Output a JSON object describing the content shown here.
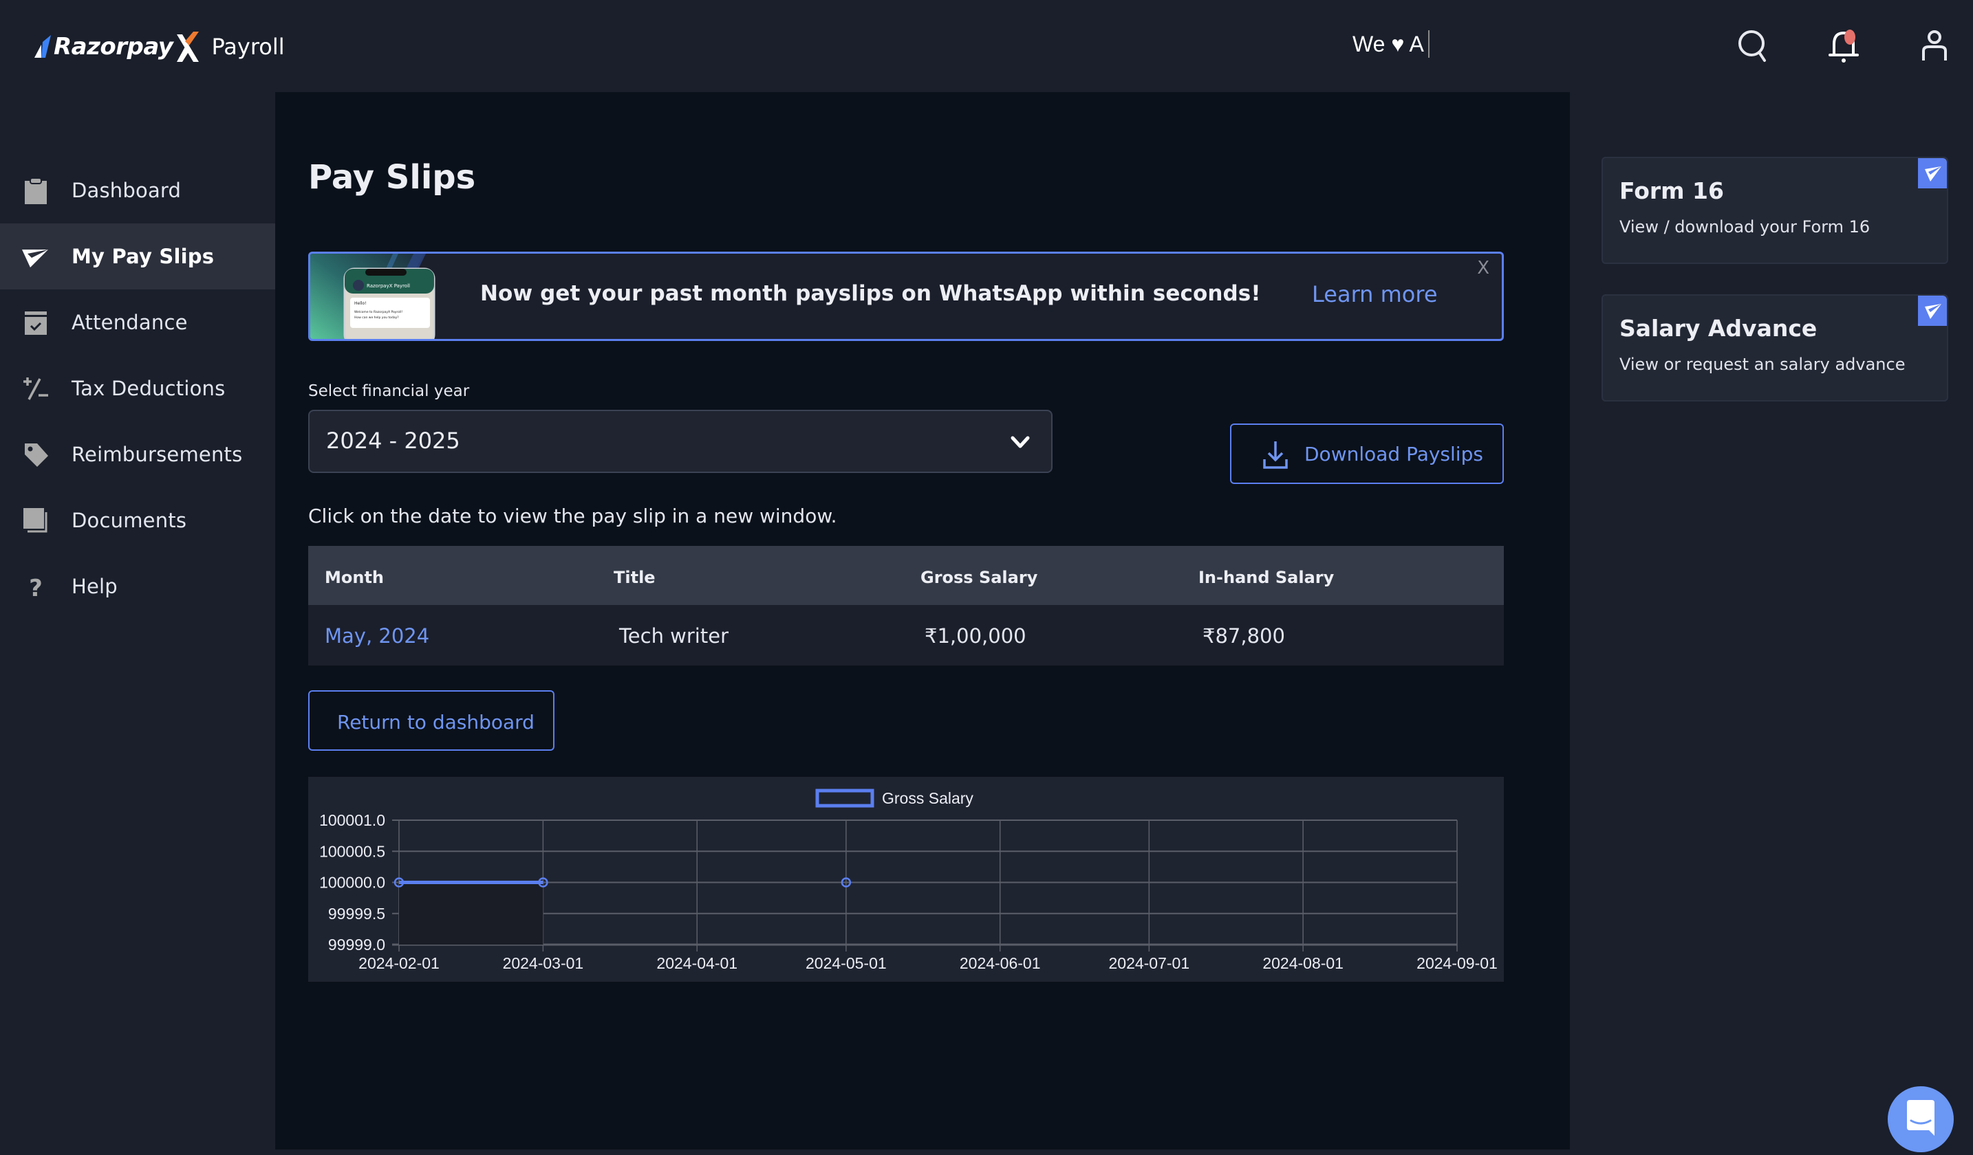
{
  "header": {
    "brand": "Razorpay",
    "product": "Payroll",
    "marquee_text": "We ♥ A",
    "icons": [
      "search-icon",
      "bell-icon",
      "user-icon"
    ],
    "notification_dot_color": "#e5716b"
  },
  "sidebar": {
    "items": [
      {
        "label": "Dashboard",
        "icon": "clipboard-icon",
        "active": false
      },
      {
        "label": "My Pay Slips",
        "icon": "paper-plane-icon",
        "active": true
      },
      {
        "label": "Attendance",
        "icon": "calendar-check-icon",
        "active": false
      },
      {
        "label": "Tax Deductions",
        "icon": "plus-minus-icon",
        "active": false
      },
      {
        "label": "Reimbursements",
        "icon": "tag-icon",
        "active": false
      },
      {
        "label": "Documents",
        "icon": "documents-icon",
        "active": false
      },
      {
        "label": "Help",
        "icon": "question-icon",
        "active": false
      }
    ]
  },
  "main": {
    "title": "Pay Slips",
    "banner": {
      "text": "Now get your past month payslips on WhatsApp within seconds!",
      "link": "Learn more",
      "close": "X",
      "phone_header": "RazorpayX Payroll",
      "phone_msg1": "Hello!",
      "phone_msg2": "Welcome to RazorpayX Payroll!",
      "phone_msg3": "How can we help you today?"
    },
    "fy_label": "Select financial year",
    "fy_value": "2024 - 2025",
    "download_label": "Download Payslips",
    "hint": "Click on the date to view the pay slip in a new window.",
    "table": {
      "headers": [
        "Month",
        "Title",
        "Gross Salary",
        "In-hand Salary"
      ],
      "rows": [
        {
          "month": "May, 2024",
          "title": "Tech writer",
          "gross": "₹1,00,000",
          "inhand": "₹87,800"
        }
      ]
    },
    "return_label": "Return to dashboard"
  },
  "right_panel": {
    "cards": [
      {
        "title": "Form 16",
        "subtitle": "View / download your Form 16"
      },
      {
        "title": "Salary Advance",
        "subtitle": "View or request an salary advance"
      }
    ]
  },
  "colors": {
    "accent": "#5b7ff0",
    "link": "#6f95f2",
    "main_bg": "#0b111a",
    "panel_bg": "#1a1f2b"
  },
  "chart_data": {
    "type": "line",
    "title": "",
    "legend": [
      {
        "name": "Gross Salary",
        "position": "top"
      }
    ],
    "series": [
      {
        "name": "Gross Salary",
        "color": "#5b7ff0",
        "points": [
          {
            "x": "2024-02-01",
            "y": 100000
          },
          {
            "x": "2024-03-01",
            "y": 100000
          },
          {
            "x": "2024-05-01",
            "y": 100000
          }
        ],
        "segments": [
          [
            "2024-02-01",
            "2024-03-01"
          ]
        ]
      }
    ],
    "x_ticks": [
      "2024-02-01",
      "2024-03-01",
      "2024-04-01",
      "2024-05-01",
      "2024-06-01",
      "2024-07-01",
      "2024-08-01",
      "2024-09-01"
    ],
    "y_ticks": [
      "100001.0",
      "100000.5",
      "100000.0",
      "99999.5",
      "99999.0"
    ],
    "y_tick_values": [
      100001.0,
      100000.5,
      100000.0,
      99999.5,
      99999.0
    ],
    "ylim": [
      99999.0,
      100001.0
    ],
    "xlabel": "",
    "ylabel": "",
    "grid": true
  }
}
